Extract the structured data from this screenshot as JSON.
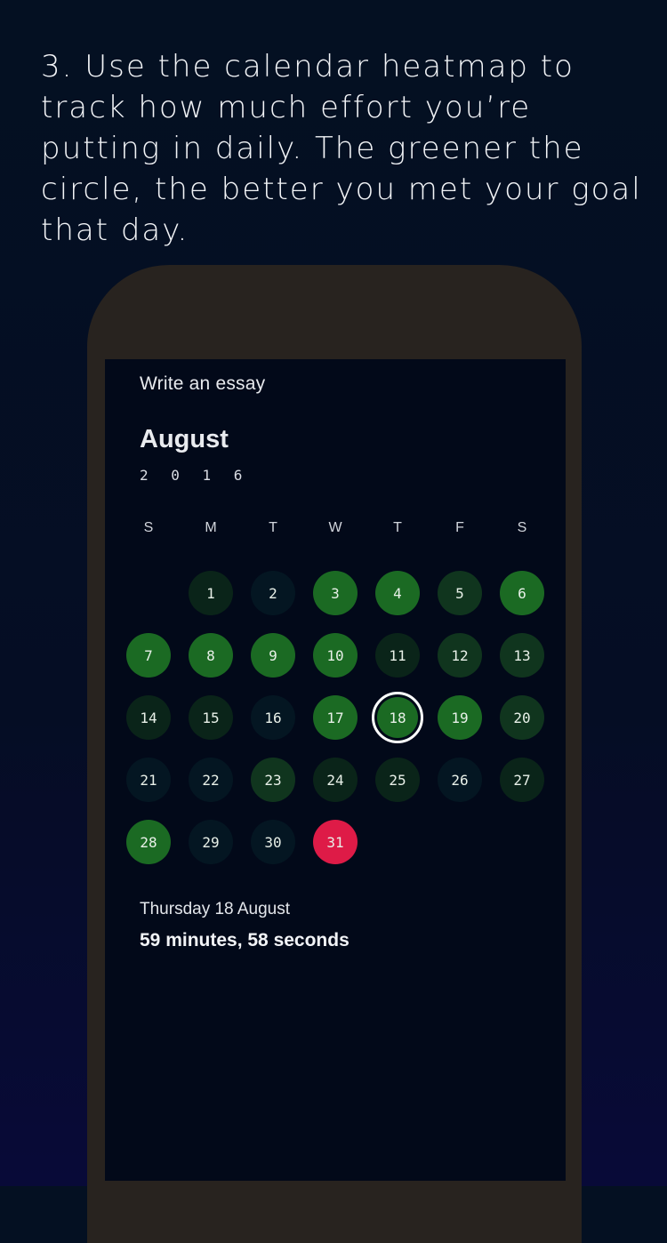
{
  "caption": "3. Use the calendar heatmap to track how much effort you’re putting in daily. The greener the circle, the better you met your goal that day.",
  "task_title": "Write an essay",
  "calendar": {
    "month": "August",
    "year": "2 0 1 6",
    "weekdays": [
      "S",
      "M",
      "T",
      "W",
      "T",
      "F",
      "S"
    ],
    "first_weekday_index": 1,
    "selected_day": 18,
    "level_colors": {
      "0": "#041622",
      "1": "#0a2419",
      "2": "#10351e",
      "3": "#1b6a23",
      "missed": "#de1b47"
    },
    "days": [
      {
        "day": "1",
        "level": "1"
      },
      {
        "day": "2",
        "level": "0"
      },
      {
        "day": "3",
        "level": "3"
      },
      {
        "day": "4",
        "level": "3"
      },
      {
        "day": "5",
        "level": "2"
      },
      {
        "day": "6",
        "level": "3"
      },
      {
        "day": "7",
        "level": "3"
      },
      {
        "day": "8",
        "level": "3"
      },
      {
        "day": "9",
        "level": "3"
      },
      {
        "day": "10",
        "level": "3"
      },
      {
        "day": "11",
        "level": "1"
      },
      {
        "day": "12",
        "level": "2"
      },
      {
        "day": "13",
        "level": "2"
      },
      {
        "day": "14",
        "level": "1"
      },
      {
        "day": "15",
        "level": "1"
      },
      {
        "day": "16",
        "level": "0"
      },
      {
        "day": "17",
        "level": "3"
      },
      {
        "day": "18",
        "level": "3"
      },
      {
        "day": "19",
        "level": "3"
      },
      {
        "day": "20",
        "level": "2"
      },
      {
        "day": "21",
        "level": "0"
      },
      {
        "day": "22",
        "level": "0"
      },
      {
        "day": "23",
        "level": "2"
      },
      {
        "day": "24",
        "level": "1"
      },
      {
        "day": "25",
        "level": "1"
      },
      {
        "day": "26",
        "level": "0"
      },
      {
        "day": "27",
        "level": "1"
      },
      {
        "day": "28",
        "level": "3"
      },
      {
        "day": "29",
        "level": "0"
      },
      {
        "day": "30",
        "level": "0"
      },
      {
        "day": "31",
        "level": "missed"
      }
    ]
  },
  "summary": {
    "date": "Thursday 18 August",
    "duration": "59 minutes, 58 seconds"
  }
}
